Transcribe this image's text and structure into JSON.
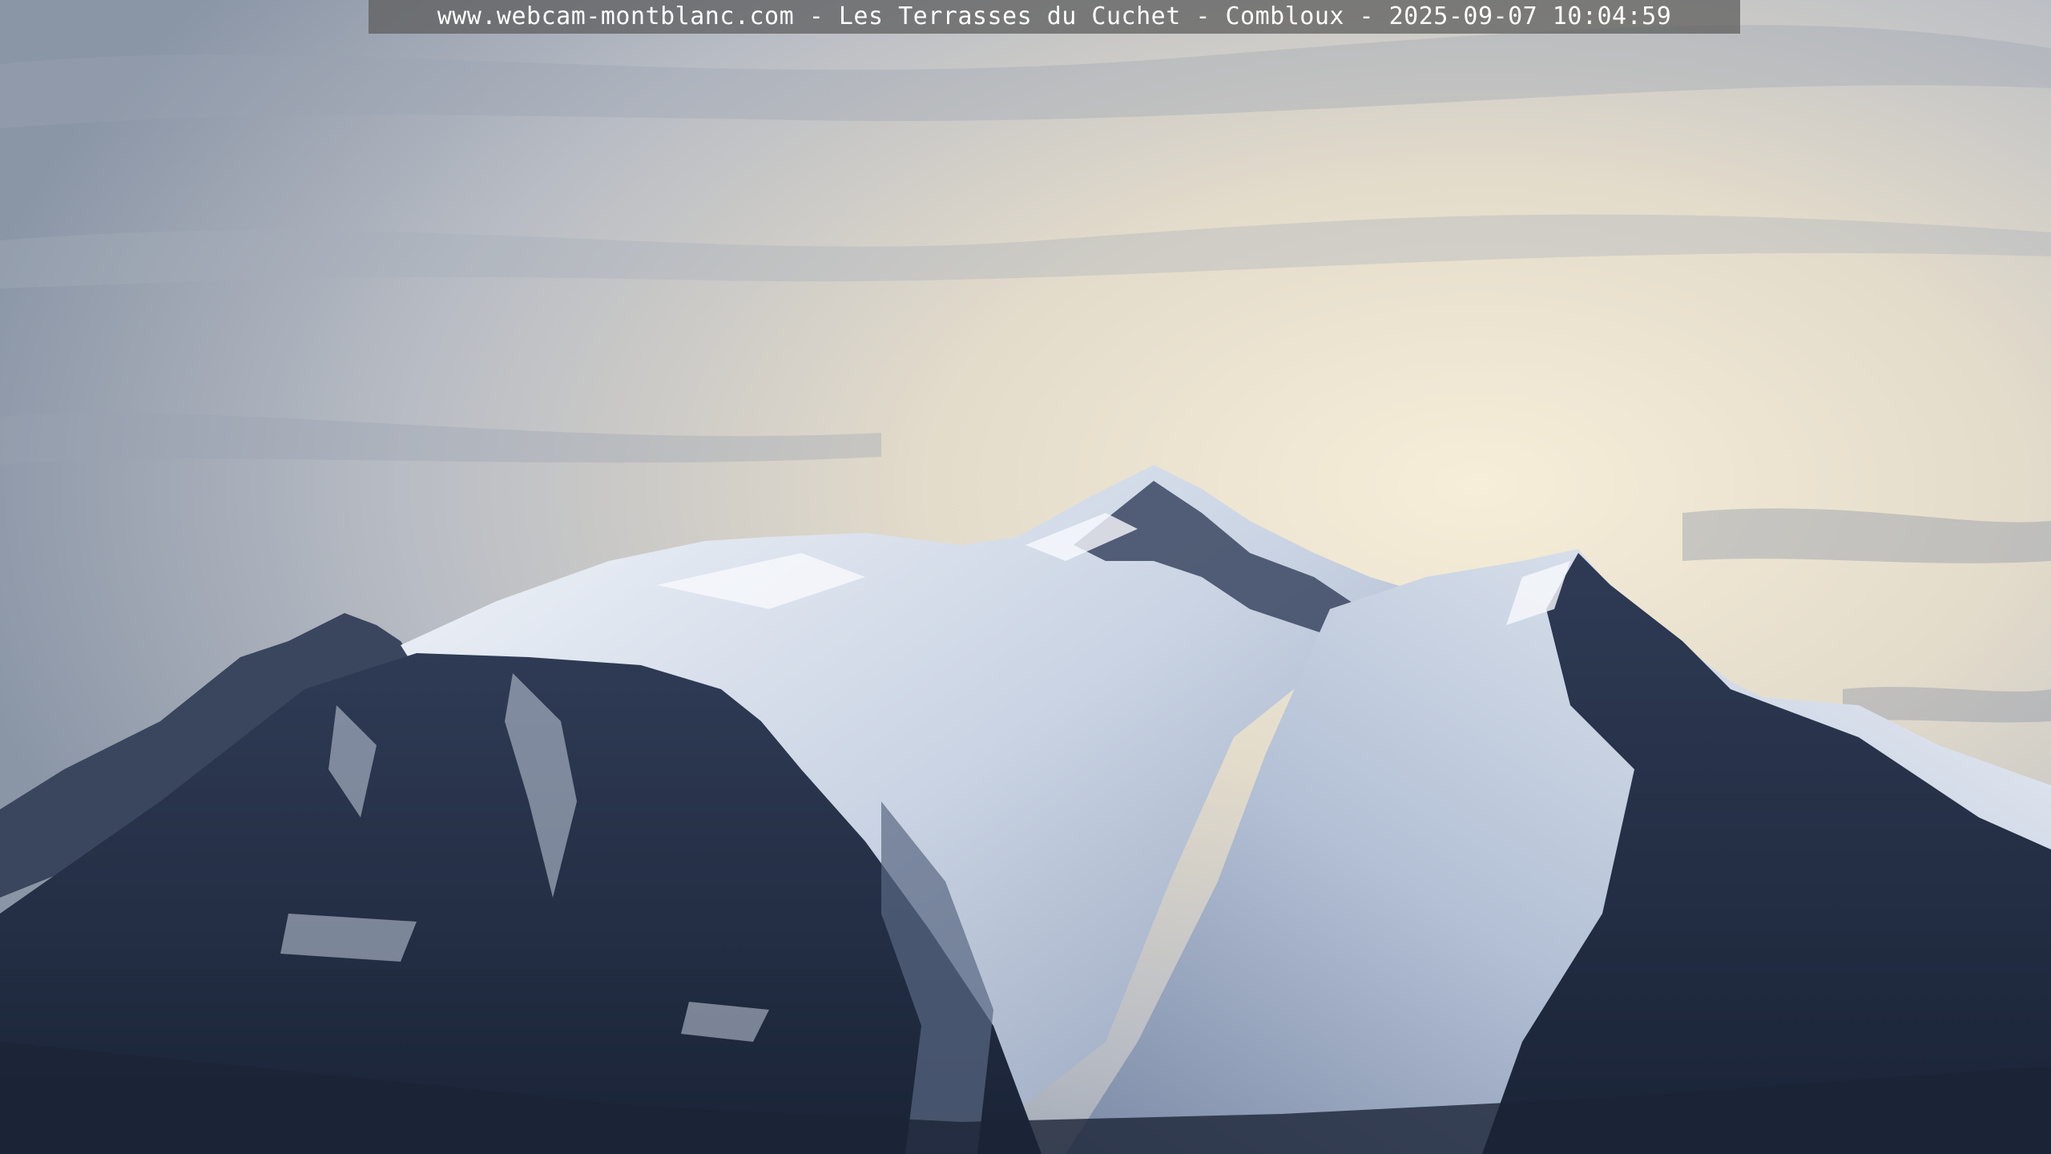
{
  "overlay": {
    "caption": "www.webcam-montblanc.com - Les Terrasses du Cuchet - Combloux - 2025-09-07 10:04:59"
  },
  "colors": {
    "sky_top": "#8e99a8",
    "sky_glow": "#f3ead2",
    "snow_light": "#e8edf5",
    "snow_shadow": "#a9b6cc",
    "rock_dark": "#1f2a40",
    "caption_bg": "#5a5a5a"
  }
}
